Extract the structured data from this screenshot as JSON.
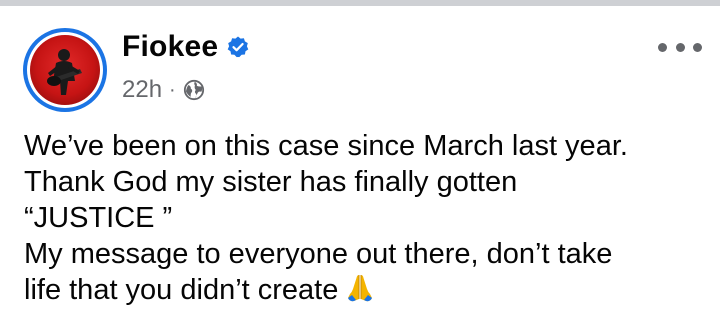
{
  "post": {
    "author": "Fiokee",
    "verified": true,
    "time": "22h",
    "separator": "·",
    "audience_icon": "globe-icon",
    "more_icon": "more-options-icon",
    "body_lines": [
      "We’ve been on this case since March last year.",
      "Thank God my sister has finally gotten",
      "“JUSTICE ”",
      "My message to everyone out there, don’t take",
      "life that you didn’t create"
    ],
    "trailing_emoji": "folded-hands-emoji"
  },
  "colors": {
    "accent": "#1b74e4",
    "text": "#050505",
    "muted": "#65676b",
    "divider": "#ced0d4"
  }
}
